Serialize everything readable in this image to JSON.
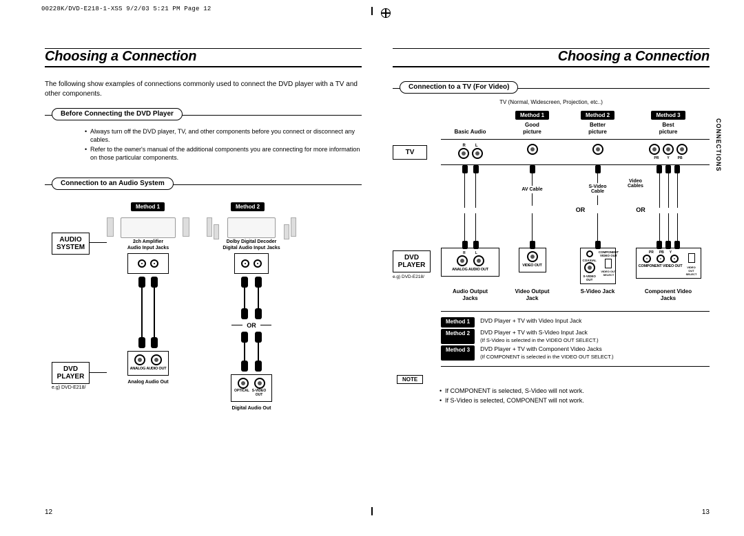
{
  "print_header": "00228K/DVD-E218-1-XSS  9/2/03 5:21 PM  Page 12",
  "left": {
    "title": "Choosing a Connection",
    "intro": "The following show examples of connections commonly used to connect the DVD player with a TV and other components.",
    "pill_before": "Before Connecting the DVD Player",
    "bullets_before": [
      "Always turn off the DVD player, TV, and other components before you connect or disconnect any cables.",
      "Refer to the owner's manual of the additional components you are connecting for more information on those particular components."
    ],
    "pill_audio": "Connection to an Audio System",
    "method1": "Method 1",
    "method2": "Method 2",
    "label_audio_system": "AUDIO\nSYSTEM",
    "equip1": "2ch Amplifier",
    "equip2": "Dolby Digital Decoder",
    "jacks1_caption": "Audio Input Jacks",
    "jacks2_caption": "Digital Audio Input Jacks",
    "or": "OR",
    "label_dvd_player": "DVD\nPLAYER",
    "eg": "e.g) DVD-E218/",
    "out1_panel": "ANALOG AUDIO OUT",
    "out2_panel_left": "OPTICAL",
    "out2_panel_right": "S-VIDEO OUT",
    "out1": "Analog Audio Out",
    "out2": "Digital Audio Out",
    "pagenum": "12"
  },
  "right": {
    "title": "Choosing a Connection",
    "side_tab": "CONNECTIONS",
    "pill_tv": "Connection to a TV (For Video)",
    "tv_types": "TV (Normal, Widescreen, Projection, etc..)",
    "col_basic_audio": "Basic Audio",
    "m1": "Method 1",
    "m2": "Method 2",
    "m3": "Method 3",
    "good": "Good\npicture",
    "better": "Better\npicture",
    "best": "Best\npicture",
    "tv_label": "TV",
    "av_cable": "AV Cable",
    "sv_cable": "S-Video\nCable",
    "video_cables": "Video\nCables",
    "or": "OR",
    "dvd_label": "DVD\nPLAYER",
    "eg": "e.g) DVD-E218/",
    "R": "R",
    "L": "L",
    "panel_analog": "ANALOG AUDIO OUT",
    "panel_video": "VIDEO OUT",
    "panel_coax": "COAXIAL",
    "panel_sv": "S-VIDEO OUT",
    "panel_switch": "VIDEO OUT SELECT",
    "panel_comp": "COMPONENT VIDEO OUT",
    "pr": "PR",
    "pb": "PB",
    "y": "Y",
    "jack_audio": "Audio Output\nJacks",
    "jack_video": "Video Output\nJack",
    "jack_sv": "S-Video Jack",
    "jack_comp": "Component Video\nJacks",
    "desc1": "DVD Player + TV with Video Input Jack",
    "desc2a": "DVD Player + TV with S-Video Input Jack",
    "desc2b": "(If S-Video is selected in the VIDEO OUT SELECT.)",
    "desc3a": "DVD Player + TV with Component Video Jacks",
    "desc3b": "(If COMPONENT is selected in the VIDEO OUT SELECT.)",
    "note_tag": "NOTE",
    "note1": "If COMPONENT is selected, S-Video will not work.",
    "note2": "If S-Video is selected, COMPONENT will not work.",
    "pagenum": "13"
  }
}
